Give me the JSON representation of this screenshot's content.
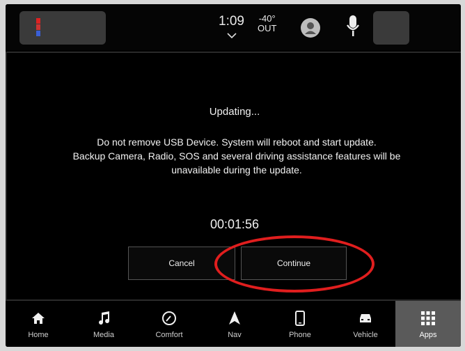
{
  "status_bar": {
    "time": "1:09",
    "temperature": "-40°",
    "temperature_label": "OUT"
  },
  "dialog": {
    "title": "Updating...",
    "message_line1": "Do not remove USB Device. System will reboot and start update.",
    "message_line2": "Backup Camera, Radio, SOS and several driving assistance features will be",
    "message_line3": "unavailable during the update.",
    "timer": "00:01:56",
    "cancel_label": "Cancel",
    "continue_label": "Continue"
  },
  "nav": {
    "items": [
      {
        "label": "Home",
        "icon": "home-icon"
      },
      {
        "label": "Media",
        "icon": "music-note-icon"
      },
      {
        "label": "Comfort",
        "icon": "climate-dial-icon"
      },
      {
        "label": "Nav",
        "icon": "navigation-arrow-icon"
      },
      {
        "label": "Phone",
        "icon": "phone-icon"
      },
      {
        "label": "Vehicle",
        "icon": "car-icon"
      },
      {
        "label": "Apps",
        "icon": "apps-grid-icon"
      }
    ],
    "active": "Apps"
  },
  "colors": {
    "highlight_ring": "#e01e1e",
    "active_tab_bg": "#5a5a5a"
  }
}
